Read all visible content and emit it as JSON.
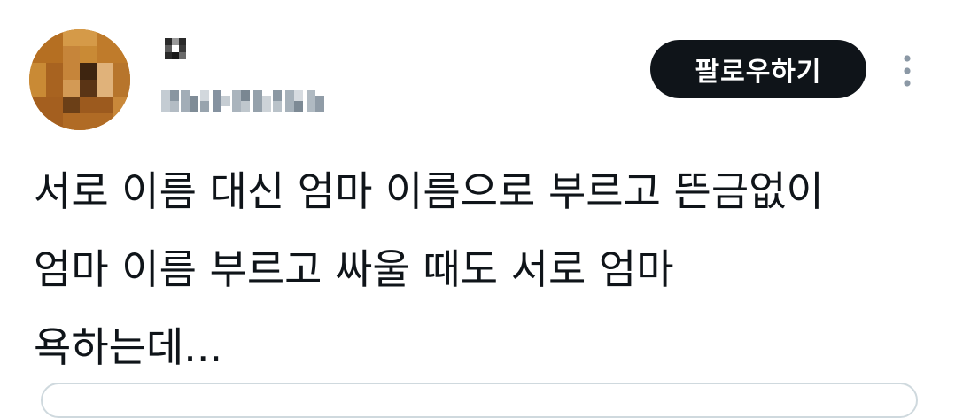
{
  "tweet": {
    "follow_label": "팔로우하기",
    "text_lines": [
      "서로 이름 대신 엄마 이름으로 부르고 뜬금없이",
      "엄마 이름 부르고 싸울 때도 서로 엄마",
      "욕하는데..."
    ]
  },
  "icons": {
    "more": "more-vertical-icon"
  },
  "colors": {
    "text": "#0f1419",
    "button_bg": "#0f1419",
    "button_text": "#ffffff",
    "muted": "#aab8c2"
  }
}
